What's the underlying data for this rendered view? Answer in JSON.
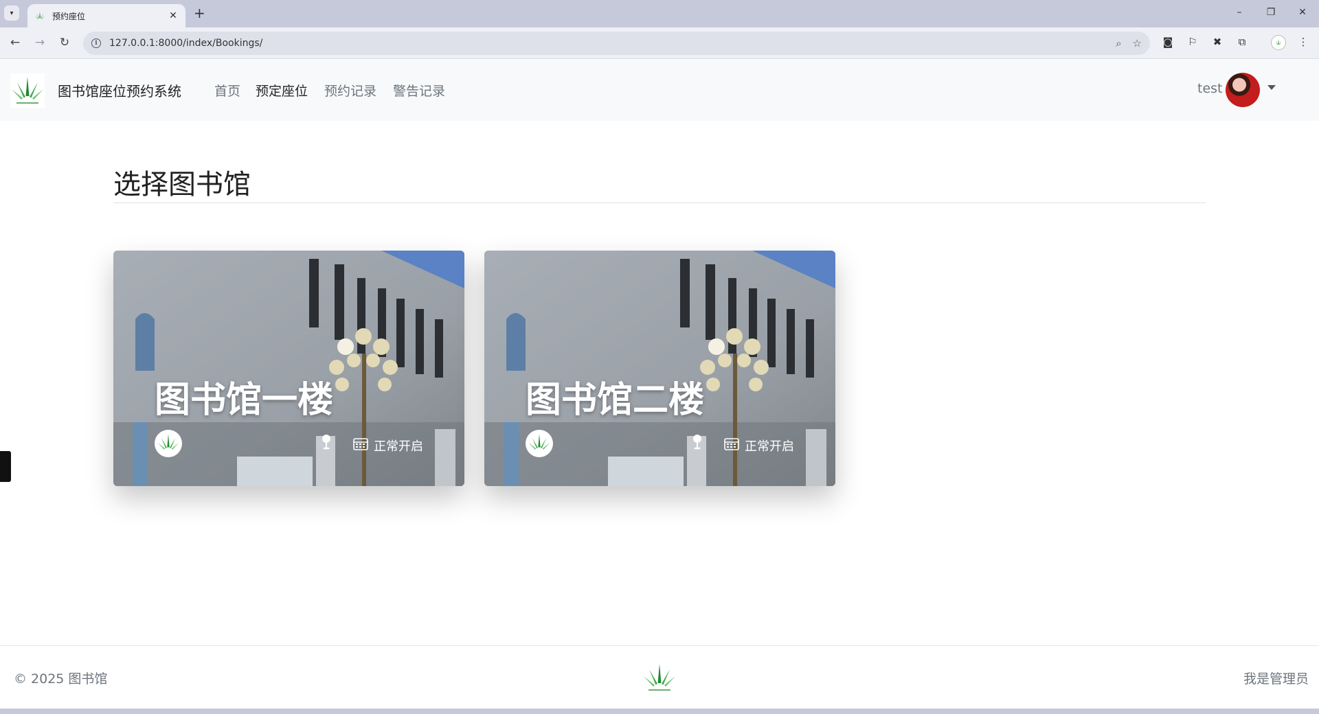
{
  "browser": {
    "tab_title": "预约座位",
    "url": "127.0.0.1:8000/index/Bookings/"
  },
  "navbar": {
    "brand": "图书馆座位预约系统",
    "links": [
      "首页",
      "预定座位",
      "预约记录",
      "警告记录"
    ],
    "active_link": "预定座位",
    "user": "test"
  },
  "main": {
    "heading": "选择图书馆",
    "cards": [
      {
        "title": "图书馆一楼",
        "status": "正常开启"
      },
      {
        "title": "图书馆二楼",
        "status": "正常开启"
      }
    ]
  },
  "footer": {
    "copyright": "© 2025 图书馆",
    "admin_link": "我是管理员"
  },
  "colors": {
    "logo_green": "#2e9b3a",
    "nav_bg": "#f8f9fa",
    "muted_text": "#6c757d"
  },
  "icons": [
    "chevron-down-icon",
    "favicon-logo",
    "close-icon",
    "plus-icon",
    "back-arrow-icon",
    "forward-arrow-icon",
    "reload-icon",
    "info-icon",
    "zoom-icon",
    "star-icon",
    "extension-icon",
    "bookmark-icon",
    "menu-dots-icon",
    "location-pin-icon",
    "calendar-icon"
  ]
}
